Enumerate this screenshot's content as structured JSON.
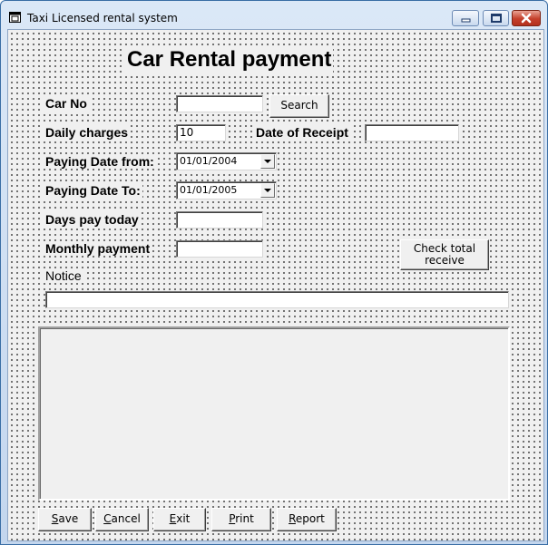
{
  "window": {
    "title": "Taxi Licensed rental system"
  },
  "form": {
    "heading": "Car Rental payment",
    "car_no": {
      "label": "Car No",
      "value": ""
    },
    "search_button": "Search",
    "daily_charges": {
      "label": "Daily charges",
      "value": "10"
    },
    "date_of_receipt": {
      "label": "Date of Receipt",
      "value": ""
    },
    "paying_date_from": {
      "label": "Paying Date from:",
      "value": "01/01/2004"
    },
    "paying_date_to": {
      "label": "Paying Date To:",
      "value": "01/01/2005"
    },
    "days_pay_today": {
      "label": "Days pay today",
      "value": ""
    },
    "monthly_payment": {
      "label": "Monthly payment",
      "value": ""
    },
    "check_total_button": {
      "line1": "Check total",
      "line2": "receive"
    },
    "notice": {
      "label": "Notice",
      "value": ""
    }
  },
  "buttons": {
    "save": {
      "mnemonic": "S",
      "rest": "ave"
    },
    "cancel": {
      "mnemonic": "C",
      "rest": "ancel"
    },
    "exit": {
      "mnemonic": "E",
      "rest": "xit"
    },
    "print": {
      "mnemonic": "P",
      "rest": "rint"
    },
    "report": {
      "mnemonic": "R",
      "rest": "eport"
    }
  },
  "icons": [
    "app-window-icon",
    "minimize-icon",
    "maximize-icon",
    "close-icon",
    "dropdown-arrow-icon"
  ]
}
